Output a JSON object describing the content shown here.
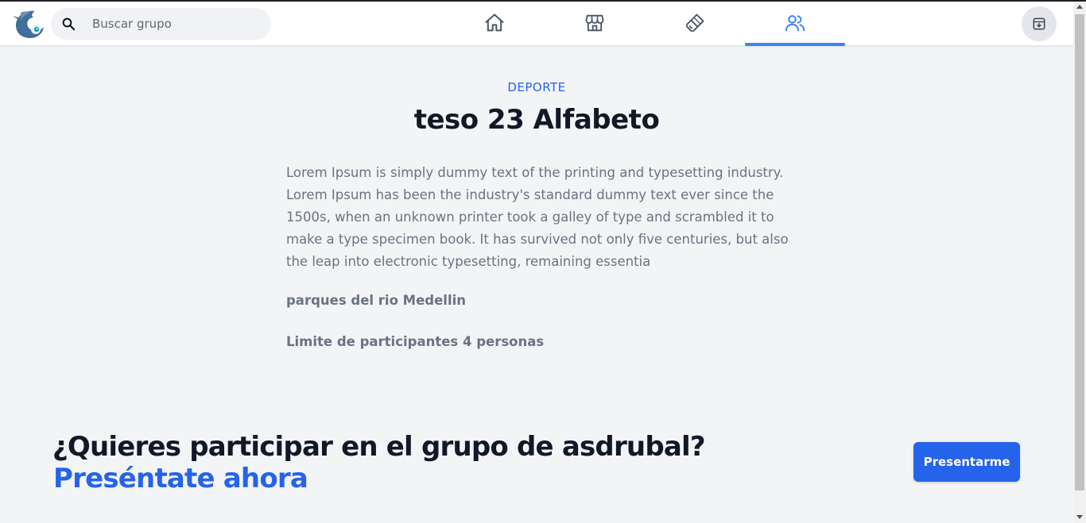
{
  "search": {
    "placeholder": "Buscar grupo",
    "icon": "search-icon"
  },
  "nav": {
    "tabs": [
      {
        "name": "home",
        "icon": "home-icon",
        "active": false
      },
      {
        "name": "store",
        "icon": "store-icon",
        "active": false
      },
      {
        "name": "brush",
        "icon": "brush-icon",
        "active": false
      },
      {
        "name": "groups",
        "icon": "users-icon",
        "active": true
      }
    ],
    "accent": "#3b82f6"
  },
  "group": {
    "category": "DEPORTE",
    "title": "teso 23 Alfabeto",
    "description": "Lorem Ipsum is simply dummy text of the printing and typesetting industry. Lorem Ipsum has been the industry's standard dummy text ever since the 1500s, when an unknown printer took a galley of type and scrambled it to make a type specimen book. It has survived not only five centuries, but also the leap into electronic typesetting, remaining essentia",
    "location": "parques del rio Medellin",
    "limit": "Limite de participantes 4 personas"
  },
  "cta": {
    "question": "¿Quieres participar en el grupo de asdrubal?",
    "action": "Preséntate ahora",
    "button_label": "Presentarme",
    "color": "#2563eb"
  }
}
